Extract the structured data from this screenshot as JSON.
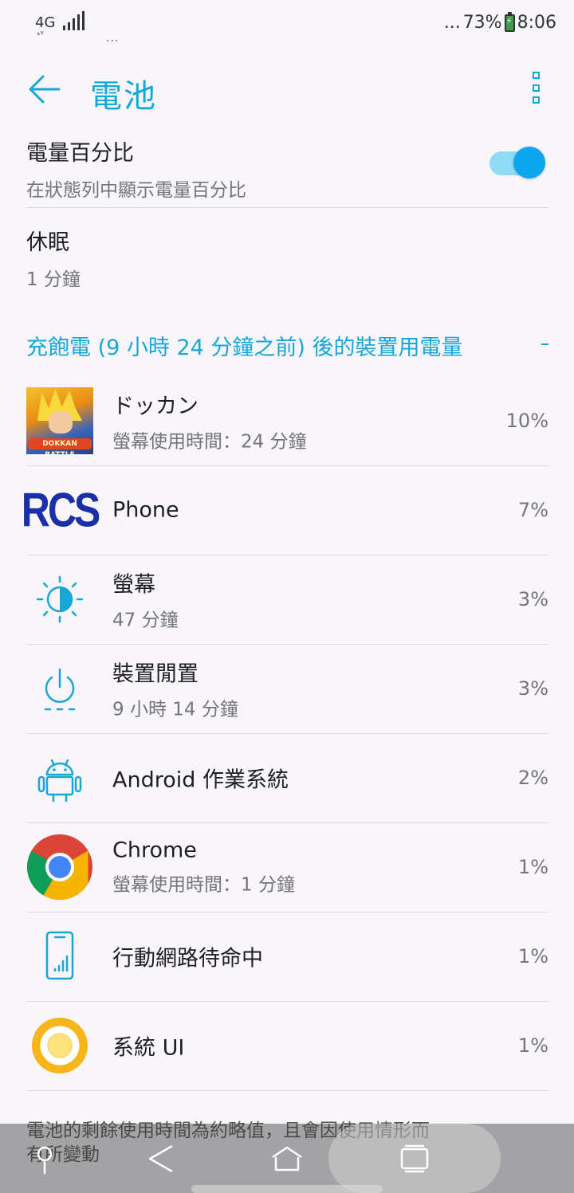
{
  "status_bar": {
    "network": "4G",
    "dots": "...",
    "battery_prefix": "...",
    "battery_percent": "73%",
    "time": "8:06"
  },
  "app_bar": {
    "title": "電池",
    "back_icon": "arrow-left-icon",
    "more_icon": "more-vert-icon"
  },
  "settings": {
    "battery_percentage": {
      "title": "電量百分比",
      "summary": "在狀態列中顯示電量百分比",
      "enabled": true
    },
    "sleep": {
      "title": "休眠",
      "summary": "1 分鐘"
    }
  },
  "usage_section": {
    "header": "充飽電 (9 小時 24 分鐘之前) 後的裝置用電量",
    "items": [
      {
        "name": "ドッカン",
        "detail": "螢幕使用時間：24 分鐘",
        "percent": "10%",
        "icon": "dokkan-battle-icon",
        "icon_text": "DOKKAN BATTLE"
      },
      {
        "name": "Phone",
        "detail": "",
        "percent": "7%",
        "icon": "rcs-icon",
        "icon_text": "RCS"
      },
      {
        "name": "螢幕",
        "detail": "47 分鐘",
        "percent": "3%",
        "icon": "brightness-icon"
      },
      {
        "name": "裝置閒置",
        "detail": "9 小時 14 分鐘",
        "percent": "3%",
        "icon": "power-icon"
      },
      {
        "name": "Android 作業系統",
        "detail": "",
        "percent": "2%",
        "icon": "android-icon"
      },
      {
        "name": "Chrome",
        "detail": "螢幕使用時間：1 分鐘",
        "percent": "1%",
        "icon": "chrome-icon"
      },
      {
        "name": "行動網路待命中",
        "detail": "",
        "percent": "1%",
        "icon": "cell-standby-icon"
      },
      {
        "name": "系統 UI",
        "detail": "",
        "percent": "1%",
        "icon": "system-ui-icon"
      }
    ]
  },
  "footer": {
    "note": "電池的剩餘使用時間為約略值，且會因使用情形而有所變動"
  },
  "nav_bar": {
    "buttons": [
      "pin-icon",
      "back-triangle-icon",
      "home-icon",
      "recents-icon"
    ]
  },
  "colors": {
    "accent": "#17a6d8",
    "toggle_thumb": "#0aa6ee",
    "toggle_track": "#8fdaf6",
    "background": "#f8f6fb"
  }
}
